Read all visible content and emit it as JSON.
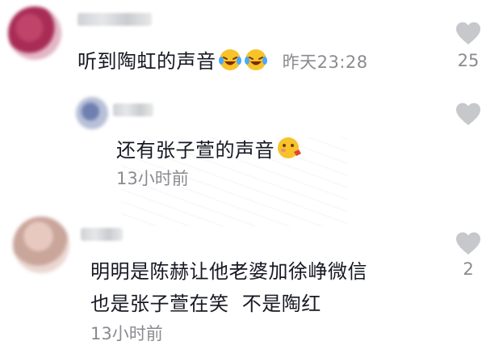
{
  "comments": [
    {
      "text": "听到陶虹的声音",
      "emojis": [
        "laughing-crying-emoji",
        "laughing-crying-emoji"
      ],
      "time": "昨天23:28",
      "likes": "25"
    },
    {
      "text": "还有张子萱的声音",
      "emojis": [
        "blushing-kiss-emoji"
      ],
      "time": "13小时前",
      "likes": ""
    },
    {
      "text_lines": [
        "明明是陈赫让他老婆加徐峥微信",
        "也是张子萱在笑  不是陶红"
      ],
      "time": "13小时前",
      "likes": "2"
    }
  ],
  "icons": {
    "like": "heart-icon"
  },
  "colors": {
    "text": "#161823",
    "meta": "#8a8b91",
    "heart": "#c7c8cc"
  }
}
